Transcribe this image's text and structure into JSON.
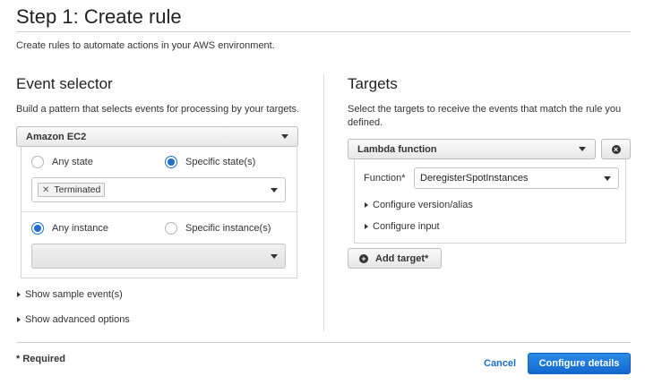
{
  "page": {
    "title": "Step 1: Create rule",
    "subtitle": "Create rules to automate actions in your AWS environment."
  },
  "event_selector": {
    "heading": "Event selector",
    "description": "Build a pattern that selects events for processing by your targets.",
    "service": "Amazon EC2",
    "state_options": [
      "Any state",
      "Specific state(s)"
    ],
    "state_selected": "Specific state(s)",
    "states": [
      "Terminated"
    ],
    "instance_options": [
      "Any instance",
      "Specific instance(s)"
    ],
    "instance_selected": "Any instance",
    "instance_value": "",
    "show_sample": "Show sample event(s)",
    "show_advanced": "Show advanced options"
  },
  "targets": {
    "heading": "Targets",
    "description": "Select the targets to receive the events that match the rule you defined.",
    "target_type": "Lambda function",
    "function_label": "Function*",
    "function_value": "DeregisterSpotInstances",
    "configure_version": "Configure version/alias",
    "configure_input": "Configure input",
    "add_target": "Add target*"
  },
  "footer": {
    "required_note": "* Required",
    "cancel": "Cancel",
    "next": "Configure details"
  },
  "colors": {
    "primary": "#1f6fd0",
    "link": "#1a6ec9"
  }
}
